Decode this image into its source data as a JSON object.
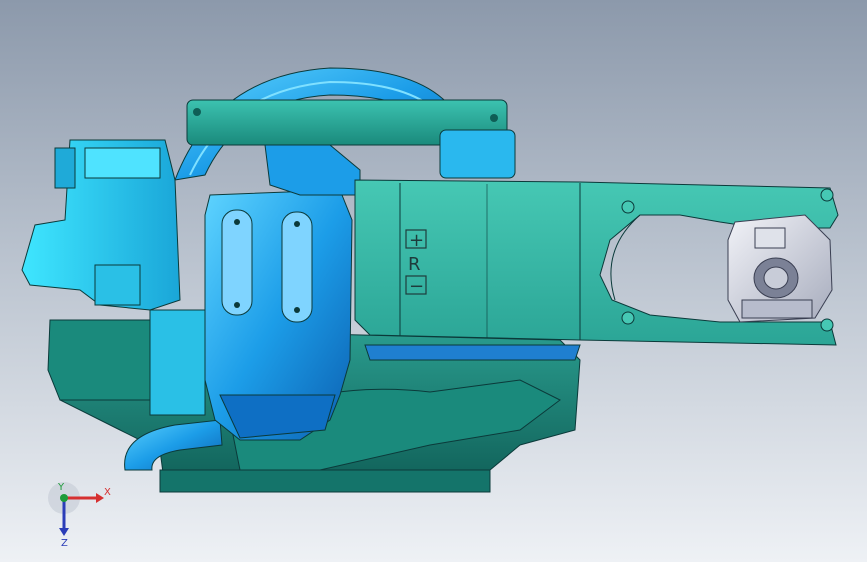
{
  "viewport": {
    "background_top": "#8c99ab",
    "background_bottom": "#eef1f5"
  },
  "model": {
    "part_colors": {
      "teal_casting": "#2fb0a0",
      "teal_dark": "#16786e",
      "blue_motor": "#1c9de8",
      "cyan_gearbox": "#38d4f0",
      "wrist_gray": "#c8ccd8",
      "edge": "#0b3a3a"
    },
    "arm_markings": {
      "plus": "+",
      "r": "R",
      "minus": "−"
    }
  },
  "triad": {
    "x_label": "X",
    "y_label": "Y",
    "z_label": "Z",
    "x_color": "#d63030",
    "y_color": "#1e9b3a",
    "z_color": "#2b3db8"
  }
}
